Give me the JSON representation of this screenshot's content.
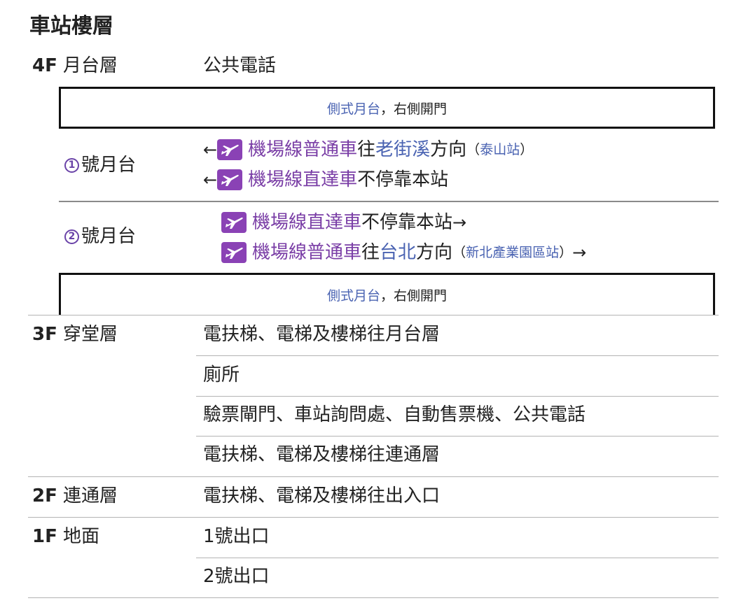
{
  "page": {
    "title": "車站樓層"
  },
  "floor_4f": {
    "code": "4F",
    "name": "月台層",
    "facility": "公共電話",
    "platform_box_top": {
      "label": "側式月台",
      "suffix": "，右側開門"
    },
    "platform_1": {
      "number": "1",
      "label": "號月台",
      "trains": [
        {
          "prefix_arrow": "←",
          "line": "機場線普通車",
          "text1": " 往",
          "dest": "老街溪",
          "text2": "方向",
          "paren_open": "（",
          "station": "泰山站",
          "paren_close": "）",
          "suffix_arrow": ""
        },
        {
          "prefix_arrow": "←",
          "line": "機場線直達車",
          "text1": " 不停靠本站",
          "dest": "",
          "text2": "",
          "paren_open": "",
          "station": "",
          "paren_close": "",
          "suffix_arrow": ""
        }
      ]
    },
    "platform_2": {
      "number": "2",
      "label": "號月台",
      "trains": [
        {
          "prefix_arrow": "",
          "line": "機場線直達車",
          "text1": " 不停靠本站",
          "dest": "",
          "text2": "",
          "paren_open": "",
          "station": "",
          "paren_close": "",
          "suffix_arrow": "→"
        },
        {
          "prefix_arrow": "",
          "line": "機場線普通車",
          "text1": " 往",
          "dest": "台北",
          "text2": "方向",
          "paren_open": "（",
          "station": "新北產業園區站",
          "paren_close": "）",
          "suffix_arrow": "→"
        }
      ]
    },
    "platform_box_bottom": {
      "label": "側式月台",
      "suffix": "，右側開門"
    }
  },
  "floor_3f": {
    "code": "3F",
    "name": "穿堂層",
    "facilities": [
      "電扶梯、電梯及樓梯往月台層",
      "廁所",
      "驗票閘門、車站詢問處、自動售票機、公共電話",
      "電扶梯、電梯及樓梯往連通層"
    ]
  },
  "floor_2f": {
    "code": "2F",
    "name": "連通層",
    "facility": "電扶梯、電梯及樓梯往出入口"
  },
  "floor_1f": {
    "code": "1F",
    "name": "地面",
    "facilities": [
      "1號出口",
      "2號出口"
    ]
  },
  "colors": {
    "link": "#4a63b2",
    "airport_line": "#8a42b5",
    "text": "#222222",
    "divider": "#b3b3b3"
  },
  "icons": {
    "airport_line": "airplane-icon"
  }
}
